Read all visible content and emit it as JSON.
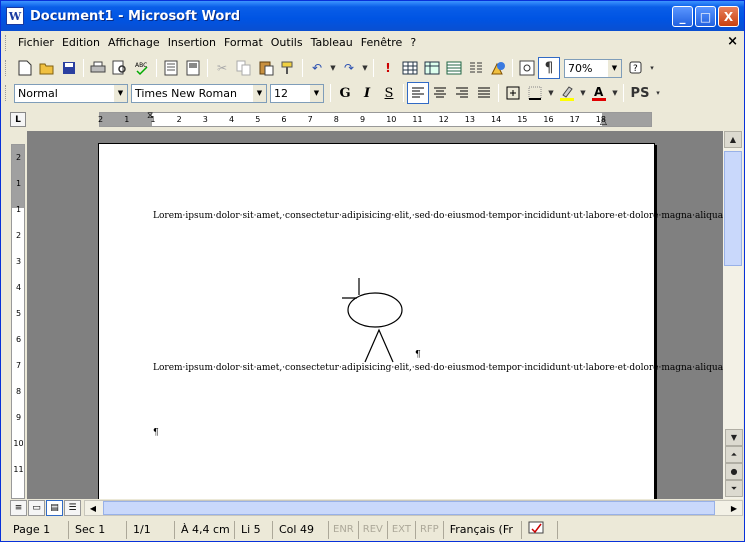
{
  "window": {
    "title": "Document1 - Microsoft Word",
    "app_icon_letter": "W"
  },
  "menu": [
    "Fichier",
    "Edition",
    "Affichage",
    "Insertion",
    "Format",
    "Outils",
    "Tableau",
    "Fenêtre",
    "?"
  ],
  "window_buttons": {
    "minimize": "_",
    "maximize": "□",
    "close": "X",
    "doc_close": "×"
  },
  "toolbar": {
    "zoom": "70%"
  },
  "format": {
    "style": "Normal",
    "font": "Times New Roman",
    "size": "12",
    "bold": "G",
    "italic": "I",
    "underline": "S",
    "ps": "PS"
  },
  "ruler": {
    "corner": "L",
    "h_labels": [
      "2",
      "1",
      "1",
      "2",
      "3",
      "4",
      "5",
      "6",
      "7",
      "8",
      "9",
      "10",
      "11",
      "12",
      "13",
      "14",
      "15",
      "16",
      "17",
      "18"
    ],
    "v_labels": [
      "2",
      "1",
      "1",
      "2",
      "3",
      "4",
      "5",
      "6",
      "7",
      "8",
      "9",
      "10",
      "11"
    ]
  },
  "document": {
    "paragraph1": "Lorem·ipsum·dolor·sit·amet,·consectetur·adipisicing·elit,·sed·do·eiusmod·tempor·incididunt·ut·labore·et·dolore·magna·aliqua.·Ut·enim·ad·minim·veniam,·quis·nostrud·exercitation·ullamco·laboris·nisi·ut·aliquip·ex·ea·commodo·consequat.·Duis·aute·irure·dolor·in·reprehenderit·in·voluptate·velit·esse·cillum·dolore·eu·fugiat·nulla·pariatur.·Excepteur·sint·occaecat·cupidatat·non·proident,·sunt·in·culpa·qui·officia·deserunt·mollit·anim·id·est·laborum.¶",
    "drawing_mark": "¶",
    "paragraph2": "Lorem·ipsum·dolor·sit·amet,·consectetur·adipisicing·elit,·sed·do·eiusmod·tempor·incididunt·ut·labore·et·dolore·magna·aliqua.·Ut·enim·ad·minim·veniam,·quis·nostrud·exercitation·ullamco·laboris·nisi·ut·aliquip·ex·ea·commodo·consequat.·Duis·aute·irure·dolor·in·reprehenderit·in·voluptate·velit·esse·cillum·dolore·eu·fugiat·nulla·pariatur.·Excepteur·sint·occaecat·cupidatat·non·proident,·sunt·in·culpa·qui·officia·deserunt·mollit·anim·id·est·laborum.¶",
    "empty_para": "¶"
  },
  "status": {
    "page": "Page 1",
    "sec": "Sec 1",
    "pages": "1/1",
    "at": "À 4,4 cm",
    "line": "Li 5",
    "col": "Col 49",
    "enr": "ENR",
    "rev": "REV",
    "ext": "EXT",
    "rfp": "RFP",
    "lang": "Français (Fr"
  }
}
